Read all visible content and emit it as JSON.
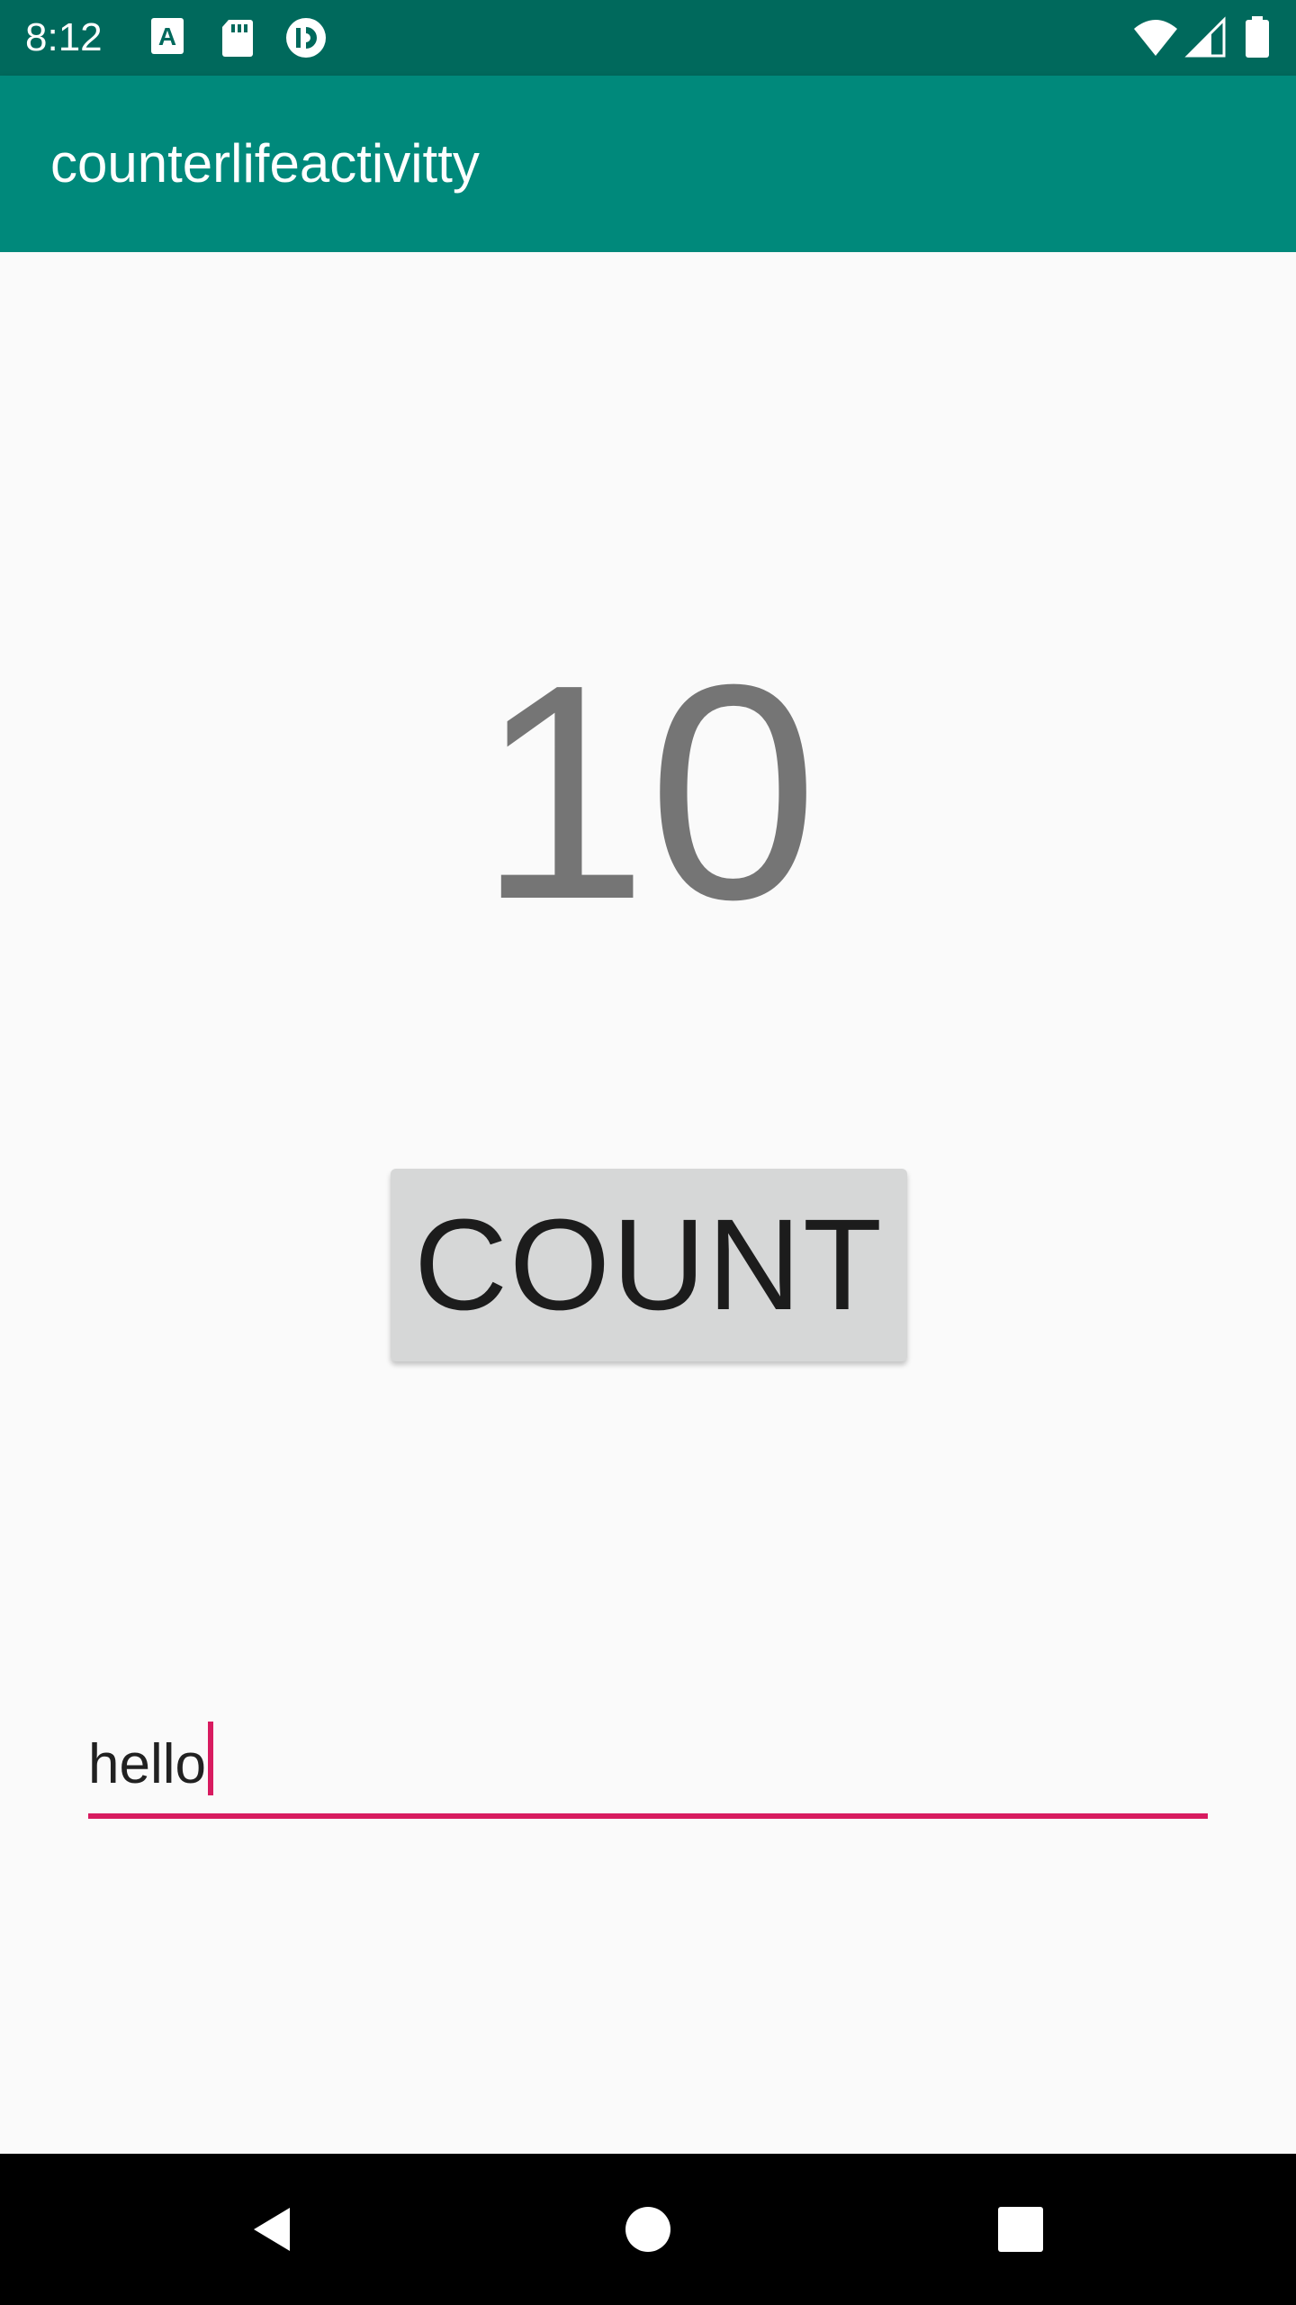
{
  "status_bar": {
    "time": "8:12",
    "icons": [
      "font-a-icon",
      "sd-card-icon",
      "sync-circle-icon",
      "wifi-icon",
      "cell-signal-icon",
      "battery-icon"
    ]
  },
  "app_bar": {
    "title": "counterlifeactivitty",
    "color": "#00897b"
  },
  "main": {
    "count_value": "10",
    "count_button_label": "COUNT",
    "input_value": "hello",
    "accent_color": "#d81b60"
  },
  "nav_bar": {
    "buttons": [
      "back-icon",
      "home-icon",
      "recents-icon"
    ]
  }
}
